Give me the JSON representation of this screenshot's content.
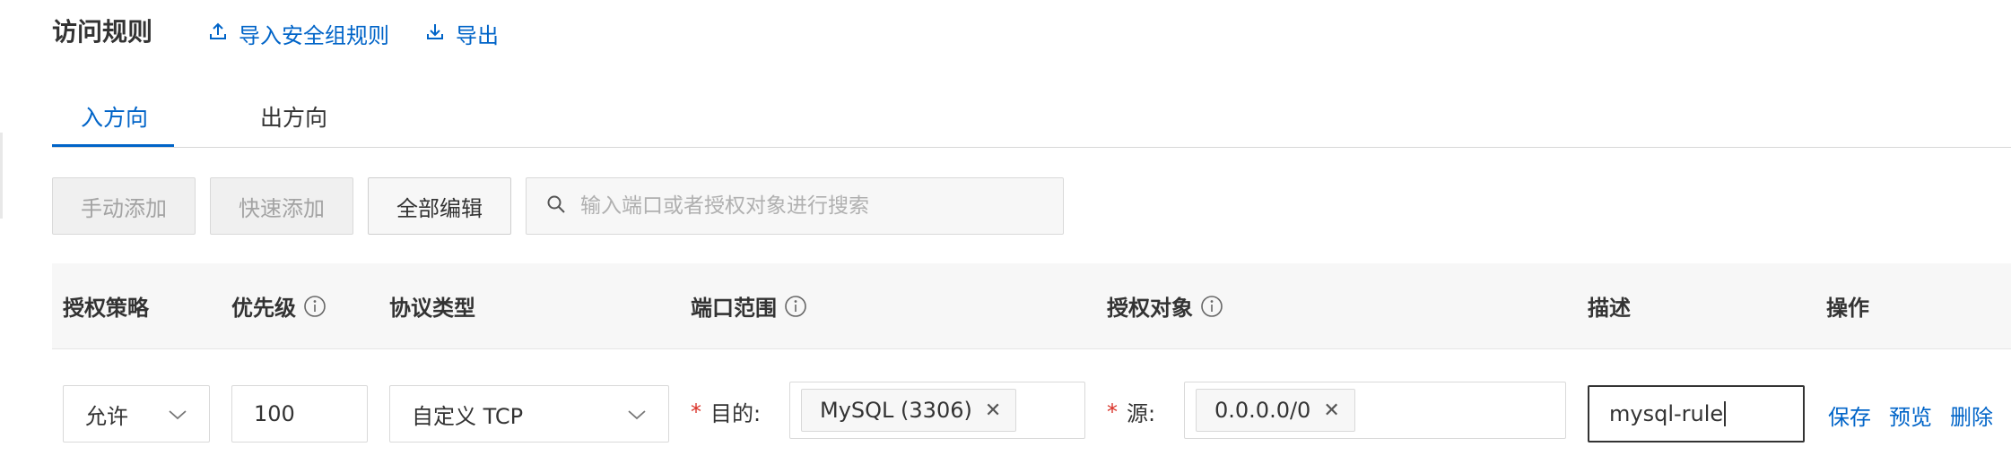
{
  "header": {
    "title": "访问规则",
    "import_label": "导入安全组规则",
    "export_label": "导出"
  },
  "tabs": [
    {
      "label": "入方向",
      "active": true
    },
    {
      "label": "出方向",
      "active": false
    }
  ],
  "toolbar": {
    "manual_add": "手动添加",
    "quick_add": "快速添加",
    "edit_all": "全部编辑",
    "search_placeholder": "输入端口或者授权对象进行搜索"
  },
  "table": {
    "columns": {
      "policy": "授权策略",
      "priority": "优先级",
      "protocol": "协议类型",
      "port_range": "端口范围",
      "auth_object": "授权对象",
      "description": "描述",
      "actions": "操作"
    },
    "row": {
      "policy": "允许",
      "priority": "100",
      "protocol": "自定义 TCP",
      "dest_label": "目的:",
      "dest_tag": "MySQL (3306)",
      "source_label": "源:",
      "source_tag": "0.0.0.0/0",
      "description": "mysql-rule",
      "actions": {
        "save": "保存",
        "preview": "预览",
        "delete": "删除"
      }
    }
  },
  "colors": {
    "accent": "#0064c8",
    "required": "#d93026"
  }
}
